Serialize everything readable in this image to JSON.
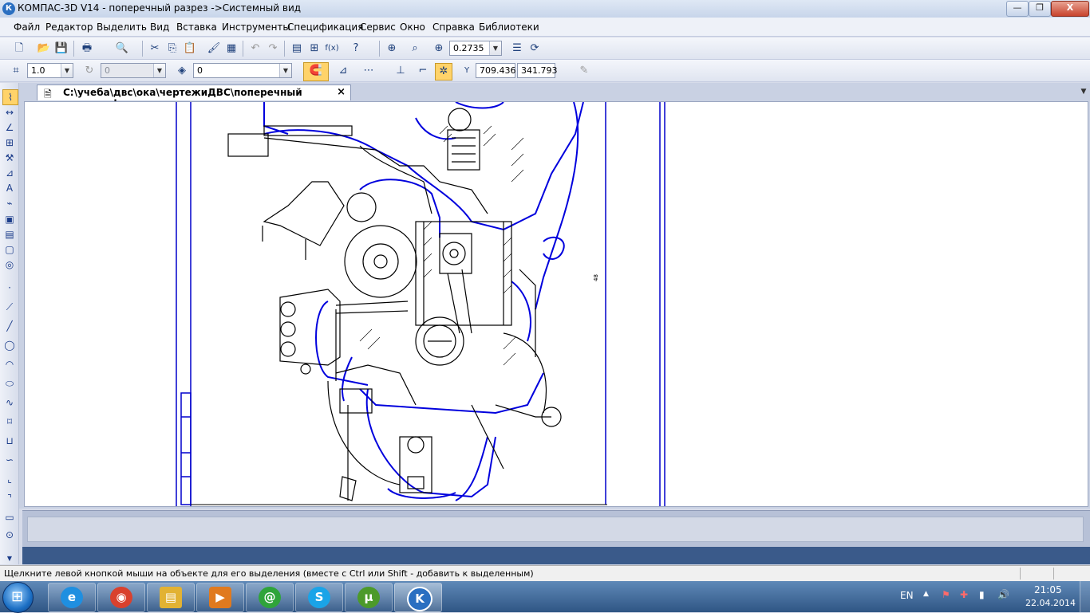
{
  "window": {
    "title": "КОМПАС-3D V14 - поперечный разрез ->Системный вид",
    "logo_letter": "К",
    "controls": {
      "minimize": "—",
      "maximize": "❐",
      "close": "X"
    }
  },
  "menu": [
    {
      "label": "Файл"
    },
    {
      "label": "Редактор"
    },
    {
      "label": "Выделить"
    },
    {
      "label": "Вид"
    },
    {
      "label": "Вставка"
    },
    {
      "label": "Инструменты"
    },
    {
      "label": "Спецификация"
    },
    {
      "label": "Сервис"
    },
    {
      "label": "Окно"
    },
    {
      "label": "Справка"
    },
    {
      "label": "Библиотеки"
    }
  ],
  "toolbar1": {
    "zoom_value": "0.2735"
  },
  "toolbar2": {
    "step_value": "1.0",
    "angle_value": "0",
    "layer_value": "0",
    "coord_x": "709.436",
    "coord_y": "341.793",
    "coord_label": "Y"
  },
  "document": {
    "tab_title": "C:\\учеба\\двс\\ока\\чертежиДВС\\поперечный разрез.cdw",
    "close_glyph": "×"
  },
  "status": {
    "hint": "Щелкните левой кнопкой мыши на объекте для его выделения (вместе с Ctrl или Shift - добавить к выделенным)"
  },
  "taskbar": {
    "apps": [
      {
        "name": "internet-explorer",
        "glyph": "e",
        "color": "#1f8fe0"
      },
      {
        "name": "chrome",
        "glyph": "◉",
        "color": "#d9412e"
      },
      {
        "name": "file-explorer",
        "glyph": "▤",
        "color": "#e2b233"
      },
      {
        "name": "media-player",
        "glyph": "▶",
        "color": "#e07a1f"
      },
      {
        "name": "mail-agent",
        "glyph": "@",
        "color": "#2fa43a"
      },
      {
        "name": "skype",
        "glyph": "S",
        "color": "#1aa4e8"
      },
      {
        "name": "utorrent",
        "glyph": "µ",
        "color": "#4c9a2a"
      },
      {
        "name": "kompas",
        "glyph": "K",
        "color": "#2a6fc1"
      }
    ],
    "language": "EN",
    "time": "21:05",
    "date": "22.04.2014"
  }
}
